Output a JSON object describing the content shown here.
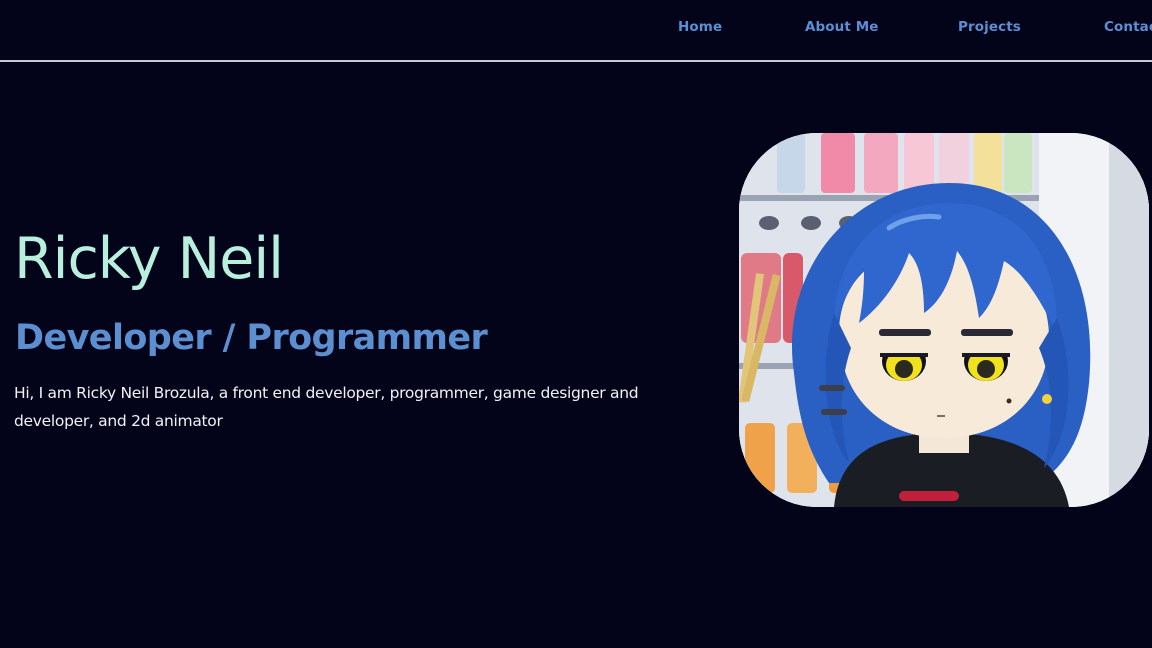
{
  "nav": {
    "home": "Home",
    "about": "About Me",
    "projects": "Projects",
    "contact": "Contac"
  },
  "hero": {
    "name": "Ricky Neil",
    "role": "Developer / Programmer",
    "bio": "Hi, I am Ricky Neil Brozula, a front end developer, programmer, game designer and developer, and 2d animator"
  },
  "portrait": {
    "icon": "anime-character-portrait"
  },
  "colors": {
    "background": "#03031a",
    "nav_link": "#5b8fd3",
    "name": "#b8efdd",
    "role": "#5c8fcf",
    "bio": "#f1f1f6",
    "divider": "#c9c9d3"
  }
}
